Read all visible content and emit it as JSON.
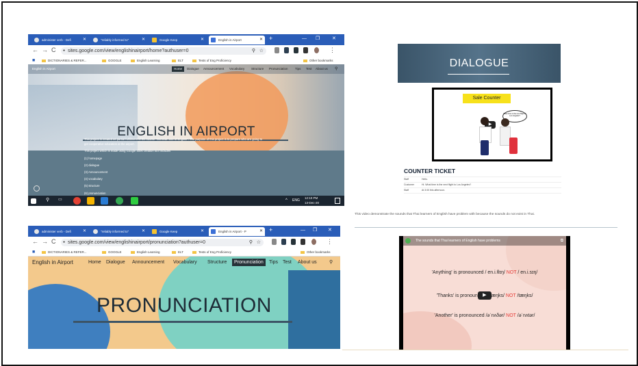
{
  "browser_top": {
    "tabs": [
      "administer verb - Defi",
      "\"reliably informed to\"",
      "Google Keep",
      "English in Airport"
    ],
    "url": "sites.google.com/view/englishinairport/home?authuser=0",
    "bookmarks": [
      "DICTIONARIES & REFER...",
      "GOOGLE",
      "English Learning",
      "ELT",
      "Tests of Eng Proficiency",
      "Other bookmarks"
    ],
    "site_name": "English in Airport",
    "nav": [
      "Home",
      "Dialogue",
      "Announcement",
      "Vocabulary",
      "Structure",
      "Pronunciation",
      "Tips",
      "Test",
      "About us"
    ],
    "hero_title": "ENGLISH IN AIRPORT",
    "body_lines": [
      "This project is created as partial fulfillment of the course \"Seminar: use of English\". The purpose of this project is to prepare who are going to",
      "get cooperative education at the airport.",
      "This project which is made using Google Sites creation tool includes",
      "(1) homepage",
      "(2) dialogue",
      "(3) Announcement",
      "(4) vocabulary",
      "(5) structure",
      "(6) pronunciation"
    ],
    "taskbar_lang": "ENG",
    "taskbar_time": "12:10 PM",
    "taskbar_date": "13-Dec-20"
  },
  "browser_bottom": {
    "tabs": [
      "administer verb - Defi",
      "\"reliably informed to\"",
      "Google Keep",
      "English in Airport - P"
    ],
    "url": "sites.google.com/view/englishinairport/pronunciation?authuser=0",
    "bookmarks": [
      "DICTIONARIES & REFER...",
      "GOOGLE",
      "English Learning",
      "ELT",
      "Tests of Eng Proficiency",
      "Other bookmarks"
    ],
    "site_name": "English in Airport",
    "nav": [
      "Home",
      "Dialogue",
      "Announcement",
      "Vocabulary",
      "Structure",
      "Pronunciation",
      "Tips",
      "Test",
      "About us"
    ],
    "hero_title": "PRONUNCIATION"
  },
  "dialogue": {
    "banner": "DIALOGUE",
    "video_label": "Sale Counter",
    "bubble": "What time is the next flight to Los Angeles?",
    "heading": "COUNTER TICKET",
    "rows": [
      {
        "who": "Staff",
        "line": "Hello."
      },
      {
        "who": "Customer",
        "line": "Hi. What time is the next flight to Los Angeles?"
      },
      {
        "who": "Staff",
        "line": "At 3:00 this afternoon."
      }
    ]
  },
  "pronunciation": {
    "intro": "This video demonstrate the sounds that Thai learners of English have problem with because the sounds do not exist in Thai.",
    "video_title": "The sounds that Thai learners of English have problems",
    "line1_a": "'Anything' is pronounced / en.i.θɪŋ/ ",
    "line1_not": "NOT",
    "line1_b": " / en.i.sɪŋ/",
    "line2_a": "'Thanks' is pronoun",
    "line2_b": "æŋks/ ",
    "line2_not": "NOT",
    "line2_c": " /tæŋks/",
    "line3_a": "'Another' is pronounced /əˈnʌðər/ ",
    "line3_not": "NOT",
    "line3_b": " /əˈnʌtər/"
  },
  "colors": {
    "chrome_blue": "#2a5db8",
    "site_slate": "#5f7a8a",
    "not_red": "#e53935"
  }
}
